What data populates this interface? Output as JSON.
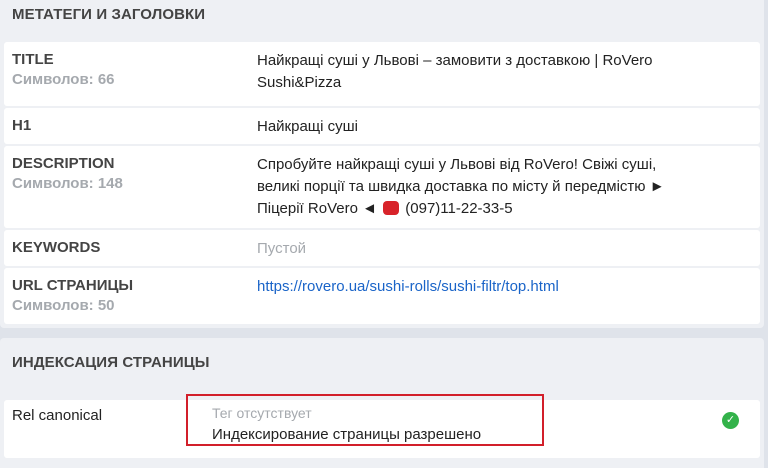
{
  "meta_section": {
    "title": "МЕТАТЕГИ И ЗАГОЛОВКИ",
    "rows": {
      "title": {
        "label": "TITLE",
        "count": "Символов: 66",
        "value": "Найкращі суші у Львові – замовити з доставкою | RoVero Sushi&Pizza"
      },
      "h1": {
        "label": "H1",
        "value": "Найкращі суші"
      },
      "description": {
        "label": "DESCRIPTION",
        "count": "Символов: 148",
        "value_before_phone": "Спробуйте найкращі суші у Львові від RoVero! Свіжі суші, великі порції та швидка доставка по місту й передмістю ► Піцерії RoVero ◄",
        "value_after_phone": "(097)11-22-33-5"
      },
      "keywords": {
        "label": "KEYWORDS",
        "value": "Пустой"
      },
      "url": {
        "label": "URL СТРАНИЦЫ",
        "count": "Символов: 50",
        "value": "https://rovero.ua/sushi-rolls/sushi-filtr/top.html"
      }
    }
  },
  "index_section": {
    "title": "ИНДЕКСАЦИЯ СТРАНИЦЫ",
    "canonical": {
      "label": "Rel canonical",
      "missing": "Тег отсутствует",
      "status": "Индексирование страницы разрешено"
    }
  },
  "icons": {
    "phone": "telephone-icon",
    "ok": "check-circle-icon"
  },
  "colors": {
    "link": "#1a64c8",
    "highlight": "#d21f2a",
    "ok": "#33b24a"
  }
}
